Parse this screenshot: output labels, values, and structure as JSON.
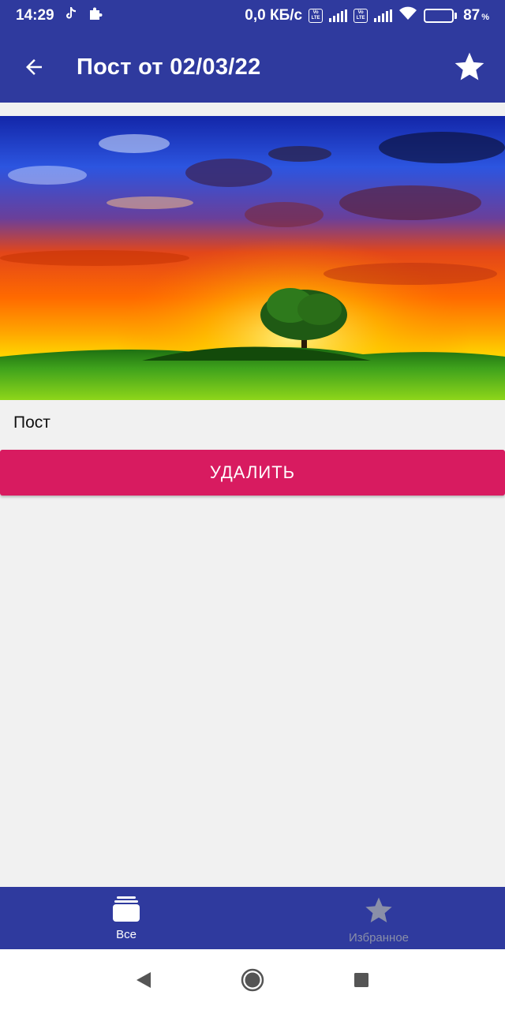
{
  "status_bar": {
    "time": "14:29",
    "network_speed": "0,0 КБ/с",
    "lte_badge_top": "Vo",
    "lte_badge_bottom": "LTE",
    "battery_percent": "87",
    "battery_unit": "%"
  },
  "app_bar": {
    "title": "Пост от 02/03/22",
    "back_icon": "arrow-back-icon",
    "favorite_icon": "star-icon"
  },
  "post": {
    "text": "Пост",
    "image_description_icon": "landscape-image",
    "delete_label": "УДАЛИТЬ"
  },
  "bottom_nav": {
    "items": [
      {
        "label": "Все",
        "icon": "stack-icon",
        "active": true
      },
      {
        "label": "Избранное",
        "icon": "star-icon",
        "active": false
      }
    ]
  },
  "colors": {
    "primary": "#2f3a9e",
    "accent": "#d81b60",
    "background": "#f1f1f1",
    "inactive_nav": "#8a8fa8"
  }
}
